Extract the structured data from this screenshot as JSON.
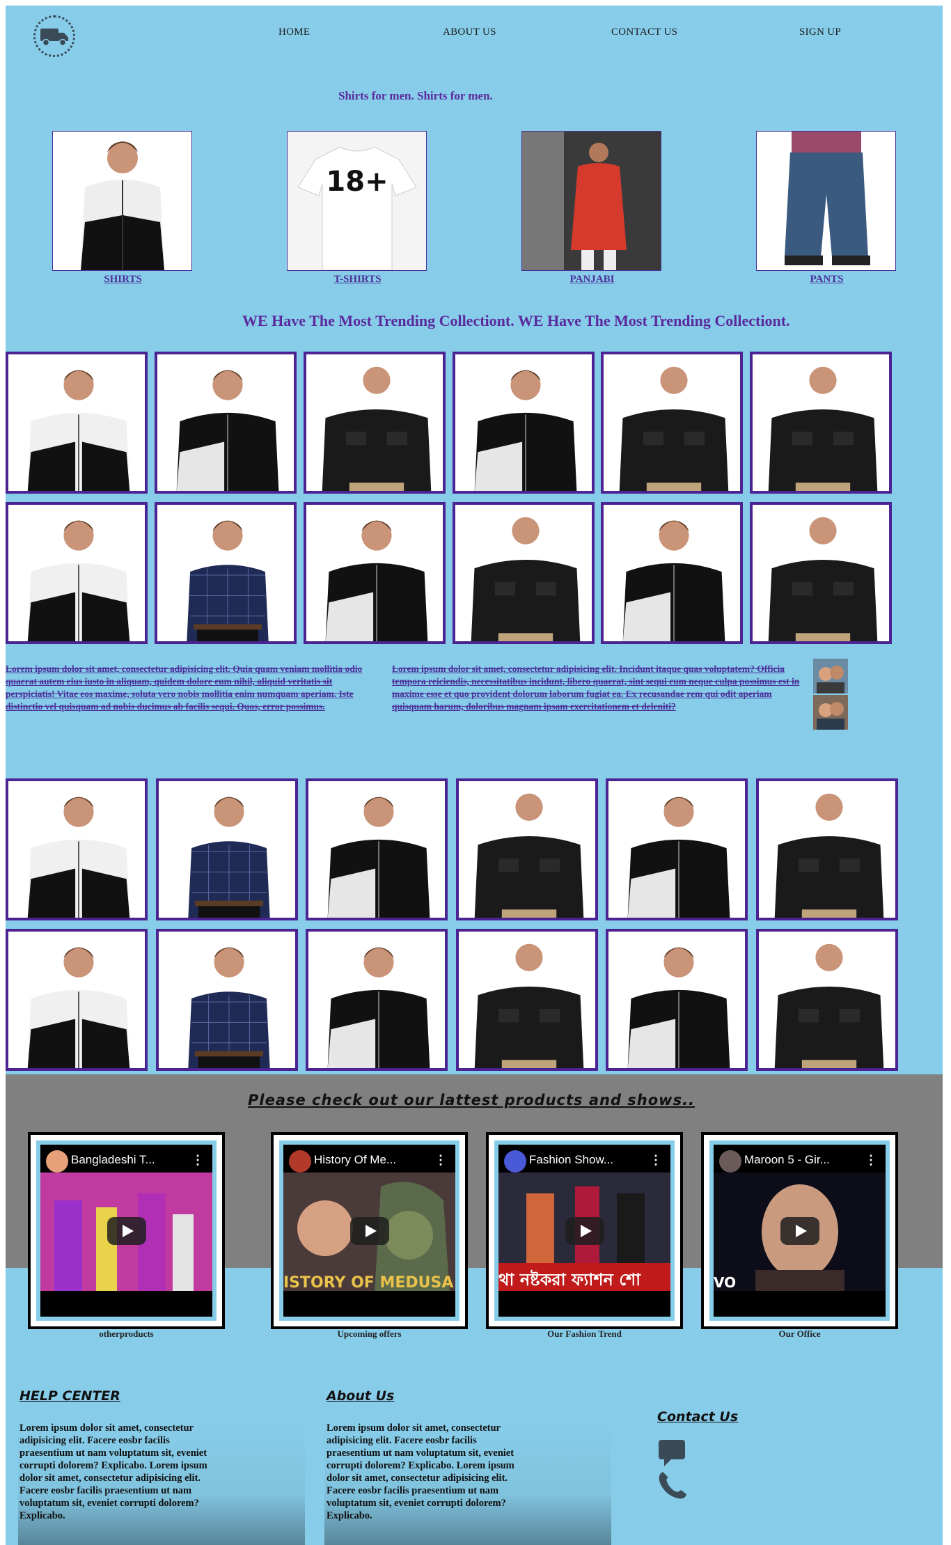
{
  "nav": {
    "items": [
      "HOME",
      "ABOUT US",
      "CONTACT US",
      "SIGN UP"
    ]
  },
  "logo": {
    "icon": "truck-icon"
  },
  "tagline": "Shirts for men. Shirts for men.",
  "categories": [
    {
      "label": "SHIRTS"
    },
    {
      "label": "T-SHIRTS"
    },
    {
      "label": "PANJABI"
    },
    {
      "label": "PANTS"
    }
  ],
  "heading": "WE Have The Most Trending Collectiont. WE Have The Most Trending Collectiont.",
  "lorem": {
    "left": "Lorem ipsum dolor sit amet, consectetur adipisicing elit. Quia quam veniam mollitia odio quaerat autem eius iusto in aliquam, quidem dolore eum nihil, aliquid veritatis sit perspiciatis! Vitae eos maxime, soluta vero nobis mollitia enim numquam aperiam. Iste distinctio vel quisquam ad nobis ducimus ab facilis sequi. Quos, error possimus.",
    "right": "Lorem ipsum dolor sit amet, consectetur adipisicing elit. Incidunt itaque quas voluptatem? Officia tempora reiciendis, necessitatibus incidunt, libero quaerat, sint sequi eum neque culpa possimus est in maxime esse et quo provident dolorum laborum fugiat ea. Ex recusandae rem qui odit aperiam quisquam harum, doloribus magnam ipsam exercitationem et deleniti?"
  },
  "band_title": "Please check out our lattest products and shows..",
  "videos": [
    {
      "title": "Bangladeshi T...",
      "caption": "otherproducts",
      "overlay": ""
    },
    {
      "title": "History Of Me...",
      "caption": "Upcoming offers",
      "overlay": "ISTORY OF MEDUSA"
    },
    {
      "title": "Fashion Show...",
      "caption": "Our Fashion Trend",
      "overlay": "থা নষ্টকরা ফ্যাশন শো"
    },
    {
      "title": "Maroon 5 - Gir...",
      "caption": "Our Office",
      "overlay": "VO"
    }
  ],
  "footer": {
    "help_title": "HELP CENTER",
    "help_text": "Lorem ipsum dolor sit amet, consectetur adipisicing elit. Facere eosbr facilis praesentium ut nam voluptatum sit, eveniet corrupti dolorem? Explicabo. Lorem ipsum dolor sit amet, consectetur adipisicing elit. Facere eosbr facilis praesentium ut nam voluptatum sit, eveniet corrupti dolorem? Explicabo.",
    "about_title": "About Us",
    "about_text": "Lorem ipsum dolor sit amet, consectetur adipisicing elit. Facere eosbr facilis praesentium ut nam voluptatum sit, eveniet corrupti dolorem? Explicabo. Lorem ipsum dolor sit amet, consectetur adipisicing elit. Facere eosbr facilis praesentium ut nam voluptatum sit, eveniet corrupti dolorem? Explicabo.",
    "contact_title": "Contact Us"
  },
  "colors": {
    "background": "#87cdea",
    "accent": "#5b2a9d",
    "tile_border": "#4b2393",
    "band": "#808080"
  }
}
